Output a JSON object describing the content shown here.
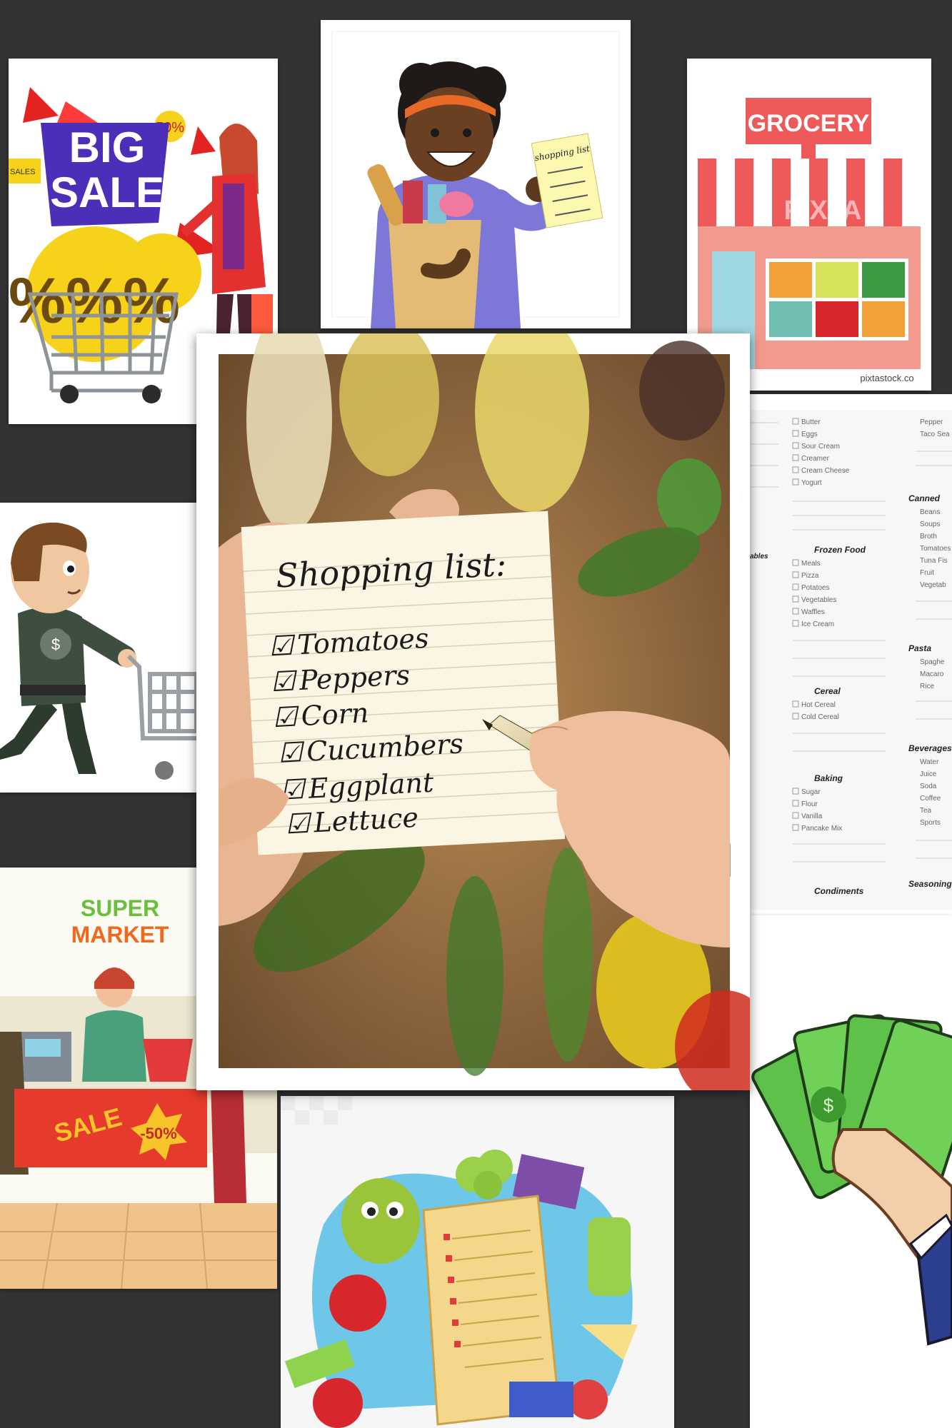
{
  "collage": {
    "big_sale": {
      "line1": "BIG",
      "line2": "SALE",
      "badge": "50%",
      "side_text": "SALES",
      "percent": "%%%"
    },
    "shopping_lady": {
      "note_title": "shopping list"
    },
    "grocery_store": {
      "sign": "GROCERY",
      "watermark": "PIXTA",
      "credit": "pixtastock.co"
    },
    "main_note": {
      "title": "Shopping list:",
      "items": [
        "Tomatoes",
        "Peppers",
        "Corn",
        "Cucumbers",
        "Eggplant",
        "Lettuce"
      ]
    },
    "printable_list": {
      "col1": [
        "Butter",
        "Eggs",
        "Sour Cream",
        "Creamer",
        "Cream Cheese",
        "Yogurt"
      ],
      "frozen_header": "Frozen Food",
      "frozen": [
        "Meals",
        "Pizza",
        "Potatoes",
        "Vegetables",
        "Waffles",
        "Ice Cream"
      ],
      "cereal_header": "Cereal",
      "cereal": [
        "Hot Cereal",
        "Cold Cereal"
      ],
      "baking_header": "Baking",
      "baking": [
        "Sugar",
        "Flour",
        "Vanilla",
        "Pancake Mix"
      ],
      "condiments_header": "Condiments",
      "col2_headers": [
        "Canned",
        "Pasta",
        "Beverages",
        "Seasonings"
      ],
      "col2": [
        "Pepper",
        "Taco Sea",
        "Beans",
        "Soups",
        "Broth",
        "Tomatoes",
        "Tuna Fis",
        "Fruit",
        "Vegetab",
        "Spaghe",
        "Macaro",
        "Rice",
        "Water",
        "Juice",
        "Soda",
        "Coffee",
        "Tea",
        "Sports"
      ],
      "col0_headers": [
        "ables"
      ]
    },
    "supermarket": {
      "title_line1": "SUPER",
      "title_line2": "MARKET",
      "sale": "SALE",
      "discount": "-50%"
    }
  },
  "colors": {
    "background": "#333333",
    "sale_purple": "#4b2fb8",
    "sale_yellow": "#f7d21b",
    "grocery_red": "#ee5a5a",
    "money_green": "#5ec24a",
    "note_paper": "#fbf6e4"
  }
}
